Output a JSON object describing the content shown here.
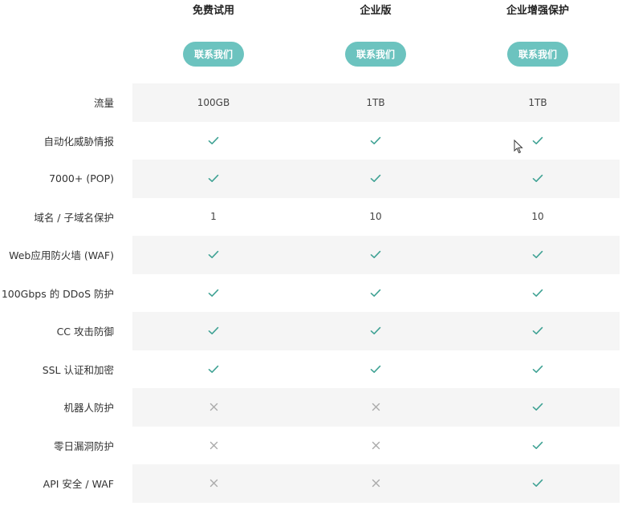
{
  "colors": {
    "accent": "#6cc3bf",
    "check": "#3fa294",
    "cross": "#aaaaaa",
    "row_shade": "#f5f5f5"
  },
  "plans": [
    {
      "title": "免费试用",
      "button": "联系我们"
    },
    {
      "title": "企业版",
      "button": "联系我们"
    },
    {
      "title": "企业增强保护",
      "button": "联系我们"
    }
  ],
  "features": [
    {
      "label": "流量",
      "values": [
        "100GB",
        "1TB",
        "1TB"
      ]
    },
    {
      "label": "自动化威胁情报",
      "values": [
        "check",
        "check",
        "check"
      ]
    },
    {
      "label": "7000+ (POP)",
      "values": [
        "check",
        "check",
        "check"
      ]
    },
    {
      "label": "域名 / 子域名保护",
      "values": [
        "1",
        "10",
        "10"
      ]
    },
    {
      "label": "Web应用防火墙 (WAF)",
      "values": [
        "check",
        "check",
        "check"
      ]
    },
    {
      "label": "100Gbps 的 DDoS 防护",
      "values": [
        "check",
        "check",
        "check"
      ]
    },
    {
      "label": "CC 攻击防御",
      "values": [
        "check",
        "check",
        "check"
      ]
    },
    {
      "label": "SSL 认证和加密",
      "values": [
        "check",
        "check",
        "check"
      ]
    },
    {
      "label": "机器人防护",
      "values": [
        "cross",
        "cross",
        "check"
      ]
    },
    {
      "label": "零日漏洞防护",
      "values": [
        "cross",
        "cross",
        "check"
      ]
    },
    {
      "label": "API 安全 / WAF",
      "values": [
        "cross",
        "cross",
        "check"
      ]
    }
  ]
}
